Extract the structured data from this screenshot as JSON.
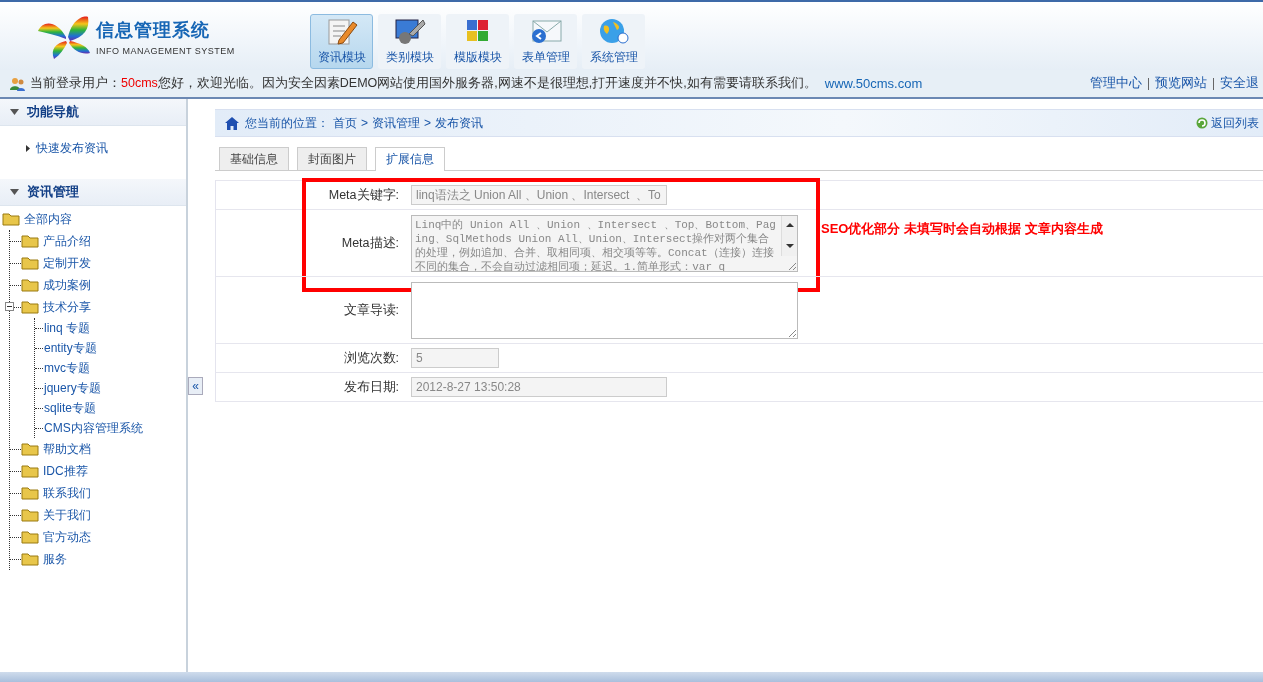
{
  "header": {
    "logo_title": "信息管理系统",
    "logo_subtitle": "INFO MANAGEMENT SYSTEM",
    "modules": [
      {
        "label": "资讯模块",
        "selected": true
      },
      {
        "label": "类别模块",
        "selected": false
      },
      {
        "label": "模版模块",
        "selected": false
      },
      {
        "label": "表单管理",
        "selected": false
      },
      {
        "label": "系统管理",
        "selected": false
      }
    ]
  },
  "user_bar": {
    "prefix": "当前登录用户：",
    "user": "50cms",
    "message": "您好，欢迎光临。因为安全因素DEMO网站使用国外服务器,网速不是很理想,打开速度并不快,如有需要请联系我们。",
    "site": "www.50cms.com",
    "links": [
      "管理中心",
      "预览网站",
      "安全退"
    ]
  },
  "sidebar": {
    "sections": [
      {
        "title": "功能导航",
        "expanded": true,
        "items": [
          "快速发布资讯"
        ]
      },
      {
        "title": "资讯管理",
        "expanded": true
      }
    ],
    "tree": [
      {
        "label": "全部内容",
        "children": [
          {
            "label": "产品介绍"
          },
          {
            "label": "定制开发"
          },
          {
            "label": "成功案例"
          },
          {
            "label": "技术分享",
            "expanded": true,
            "children": [
              {
                "label": "linq 专题"
              },
              {
                "label": "entity专题"
              },
              {
                "label": "mvc专题"
              },
              {
                "label": "jquery专题"
              },
              {
                "label": "sqlite专题"
              },
              {
                "label": "CMS内容管理系统"
              }
            ]
          },
          {
            "label": "帮助文档"
          },
          {
            "label": "IDC推荐"
          },
          {
            "label": "联系我们"
          },
          {
            "label": "关于我们"
          },
          {
            "label": "官方动态"
          },
          {
            "label": "服务"
          }
        ]
      }
    ],
    "collapse_button": "«"
  },
  "breadcrumb": {
    "prefix": "您当前的位置：",
    "path": [
      "首页",
      "资讯管理",
      "发布资讯"
    ],
    "separator": ">",
    "back_link": "返回列表"
  },
  "tabs": [
    {
      "label": "基础信息",
      "selected": false
    },
    {
      "label": "封面图片",
      "selected": false
    },
    {
      "label": "扩展信息",
      "selected": true
    }
  ],
  "form": {
    "seo_group": {
      "note": "SEO优化部分 未填写时会自动根据 文章内容生成",
      "fields": [
        {
          "label": "Meta关键字:",
          "kind": "text",
          "value": "linq语法之 Union All 、Union 、Intersect  、To"
        },
        {
          "label": "Meta描述:",
          "kind": "textarea",
          "value": "Linq中的 Union All 、Union 、Intersect  、Top、Bottom、Paging、SqlMethods Union All、Union、Intersect操作对两个集合的处理，例如追加、合并、取相同项、相交项等等。Concat（连接）连接不同的集合，不会自动过滤相同项；延迟。1.简单形式：var q"
        }
      ]
    },
    "fields": [
      {
        "label": "文章导读:",
        "kind": "textarea"
      },
      {
        "label": "浏览次数:",
        "kind": "short",
        "value": "5"
      },
      {
        "label": "发布日期:",
        "kind": "text",
        "value": "2012-8-27 13:50:28"
      }
    ]
  }
}
